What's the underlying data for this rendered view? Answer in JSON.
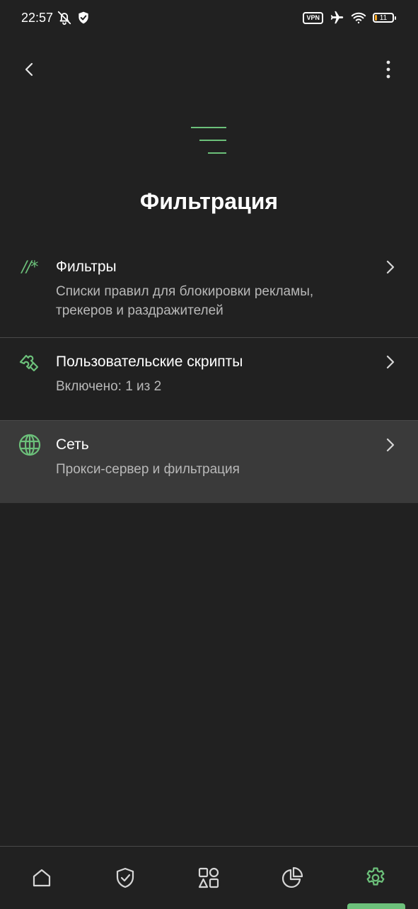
{
  "status_bar": {
    "time": "22:57",
    "vpn_label": "VPN",
    "battery_level": "11"
  },
  "top_bar": {
    "back_icon": "chevron-left-icon",
    "more_icon": "more-vert-icon"
  },
  "page": {
    "title": "Фильтрация",
    "header_icon": "filter-lines-icon"
  },
  "items": [
    {
      "icon": "regex-icon",
      "icon_text": "//*",
      "title": "Фильтры",
      "subtitle": "Списки правил для блокировки рекламы, трекеров и раздражителей"
    },
    {
      "icon": "puzzle-icon",
      "title": "Пользовательские скрипты",
      "subtitle": "Включено: 1 из 2"
    },
    {
      "icon": "globe-icon",
      "title": "Сеть",
      "subtitle": "Прокси-сервер и фильтрация"
    }
  ],
  "bottom_nav": {
    "items": [
      "home-icon",
      "shield-check-icon",
      "shapes-icon",
      "pie-chart-icon",
      "settings-icon"
    ],
    "active_index": 4
  },
  "colors": {
    "background": "#212121",
    "accent": "#6cc07a",
    "highlight": "#3a3a3a",
    "text_secondary": "#b8b8b8"
  }
}
